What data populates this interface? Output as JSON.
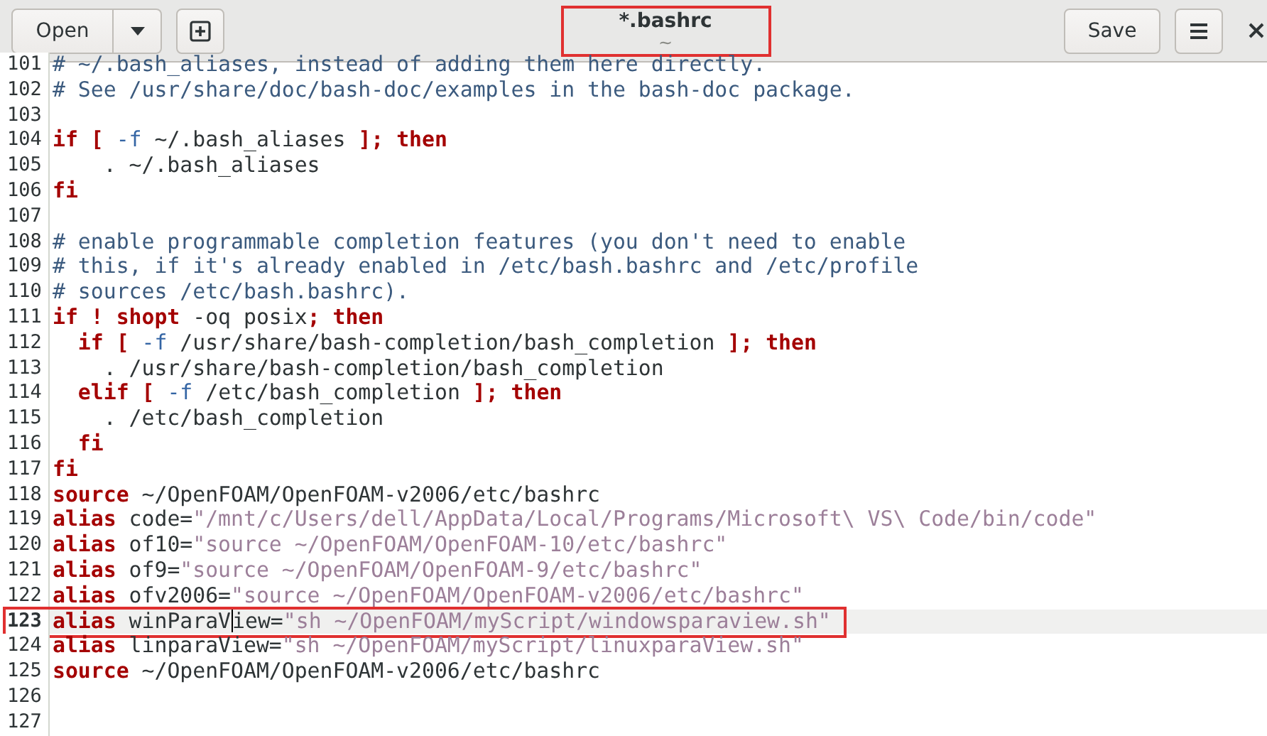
{
  "header": {
    "open_button": "Open",
    "title": "*.bashrc",
    "subtitle": "~",
    "title_annotated": true,
    "save_button": "Save"
  },
  "editor": {
    "lines": [
      {
        "number": "101",
        "current": false,
        "annotated": false,
        "tokens": [
          {
            "kind": "comment",
            "text": "# ~/.bash_aliases, instead of adding them here directly."
          }
        ]
      },
      {
        "number": "102",
        "current": false,
        "annotated": false,
        "tokens": [
          {
            "kind": "comment",
            "text": "# See /usr/share/doc/bash-doc/examples in the bash-doc package."
          }
        ]
      },
      {
        "number": "103",
        "current": false,
        "annotated": false
      },
      {
        "number": "104",
        "current": false,
        "annotated": false,
        "tokens": [
          {
            "kind": "keyword",
            "text": "if ["
          },
          {
            "kind": "option",
            "text": " -f"
          },
          {
            "kind": "plain",
            "text": " ~/.bash_aliases "
          },
          {
            "kind": "keyword",
            "text": "]; then"
          }
        ]
      },
      {
        "number": "105",
        "current": false,
        "annotated": false,
        "tokens": [
          {
            "kind": "plain",
            "text": "    . ~/.bash_aliases"
          }
        ]
      },
      {
        "number": "106",
        "current": false,
        "annotated": false,
        "tokens": [
          {
            "kind": "keyword",
            "text": "fi"
          }
        ]
      },
      {
        "number": "107",
        "current": false,
        "annotated": false
      },
      {
        "number": "108",
        "current": false,
        "annotated": false,
        "tokens": [
          {
            "kind": "comment",
            "text": "# enable programmable completion features (you don't need to enable"
          }
        ]
      },
      {
        "number": "109",
        "current": false,
        "annotated": false,
        "tokens": [
          {
            "kind": "comment",
            "text": "# this, if it's already enabled in /etc/bash.bashrc and /etc/profile"
          }
        ]
      },
      {
        "number": "110",
        "current": false,
        "annotated": false,
        "tokens": [
          {
            "kind": "comment",
            "text": "# sources /etc/bash.bashrc)."
          }
        ]
      },
      {
        "number": "111",
        "current": false,
        "annotated": false,
        "tokens": [
          {
            "kind": "keyword",
            "text": "if ! shopt"
          },
          {
            "kind": "plain",
            "text": " -oq posix"
          },
          {
            "kind": "keyword",
            "text": "; then"
          }
        ]
      },
      {
        "number": "112",
        "current": false,
        "annotated": false,
        "tokens": [
          {
            "kind": "keyword",
            "text": "  if ["
          },
          {
            "kind": "option",
            "text": " -f"
          },
          {
            "kind": "plain",
            "text": " /usr/share/bash-completion/bash_completion "
          },
          {
            "kind": "keyword",
            "text": "]; then"
          }
        ]
      },
      {
        "number": "113",
        "current": false,
        "annotated": false,
        "tokens": [
          {
            "kind": "plain",
            "text": "    . /usr/share/bash-completion/bash_completion"
          }
        ]
      },
      {
        "number": "114",
        "current": false,
        "annotated": false,
        "tokens": [
          {
            "kind": "keyword",
            "text": "  elif ["
          },
          {
            "kind": "option",
            "text": " -f"
          },
          {
            "kind": "plain",
            "text": " /etc/bash_completion "
          },
          {
            "kind": "keyword",
            "text": "]; then"
          }
        ]
      },
      {
        "number": "115",
        "current": false,
        "annotated": false,
        "tokens": [
          {
            "kind": "plain",
            "text": "    . /etc/bash_completion"
          }
        ]
      },
      {
        "number": "116",
        "current": false,
        "annotated": false,
        "tokens": [
          {
            "kind": "keyword",
            "text": "  fi"
          }
        ]
      },
      {
        "number": "117",
        "current": false,
        "annotated": false,
        "tokens": [
          {
            "kind": "keyword",
            "text": "fi"
          }
        ]
      },
      {
        "number": "118",
        "current": false,
        "annotated": false,
        "tokens": [
          {
            "kind": "keyword",
            "text": "source"
          },
          {
            "kind": "plain",
            "text": " ~/OpenFOAM/OpenFOAM-v2006/etc/bashrc"
          }
        ]
      },
      {
        "number": "119",
        "current": false,
        "annotated": false,
        "tokens": [
          {
            "kind": "keyword",
            "text": "alias"
          },
          {
            "kind": "plain",
            "text": " code="
          },
          {
            "kind": "string",
            "text": "\"/mnt/c/Users/dell/AppData/Local/Programs/Microsoft\\ VS\\ Code/bin/code\""
          }
        ]
      },
      {
        "number": "120",
        "current": false,
        "annotated": false,
        "tokens": [
          {
            "kind": "keyword",
            "text": "alias"
          },
          {
            "kind": "plain",
            "text": " of10="
          },
          {
            "kind": "string",
            "text": "\"source ~/OpenFOAM/OpenFOAM-10/etc/bashrc\""
          }
        ]
      },
      {
        "number": "121",
        "current": false,
        "annotated": false,
        "tokens": [
          {
            "kind": "keyword",
            "text": "alias"
          },
          {
            "kind": "plain",
            "text": " of9="
          },
          {
            "kind": "string",
            "text": "\"source ~/OpenFOAM/OpenFOAM-9/etc/bashrc\""
          }
        ]
      },
      {
        "number": "122",
        "current": false,
        "annotated": false,
        "tokens": [
          {
            "kind": "keyword",
            "text": "alias"
          },
          {
            "kind": "plain",
            "text": " ofv2006="
          },
          {
            "kind": "string",
            "text": "\"source ~/OpenFOAM/OpenFOAM-v2006/etc/bashrc\""
          }
        ]
      },
      {
        "number": "123",
        "current": true,
        "annotated": true,
        "tokens": [
          {
            "kind": "keyword",
            "text": "alias"
          },
          {
            "kind": "plain",
            "text": " winParaV"
          },
          {
            "kind": "cursor"
          },
          {
            "kind": "plain",
            "text": "iew="
          },
          {
            "kind": "string",
            "text": "\"sh ~/OpenFOAM/myScript/windowsparaview.sh\""
          }
        ]
      },
      {
        "number": "124",
        "current": false,
        "annotated": false,
        "tokens": [
          {
            "kind": "keyword",
            "text": "alias"
          },
          {
            "kind": "plain",
            "text": " linparaView="
          },
          {
            "kind": "string",
            "text": "\"sh ~/OpenFOAM/myScript/linuxparaView.sh\""
          }
        ]
      },
      {
        "number": "125",
        "current": false,
        "annotated": false,
        "tokens": [
          {
            "kind": "keyword",
            "text": "source"
          },
          {
            "kind": "plain",
            "text": " ~/OpenFOAM/OpenFOAM-v2006/etc/bashrc"
          }
        ]
      },
      {
        "number": "126",
        "current": false,
        "annotated": false
      },
      {
        "number": "127",
        "current": false,
        "annotated": false
      }
    ]
  }
}
